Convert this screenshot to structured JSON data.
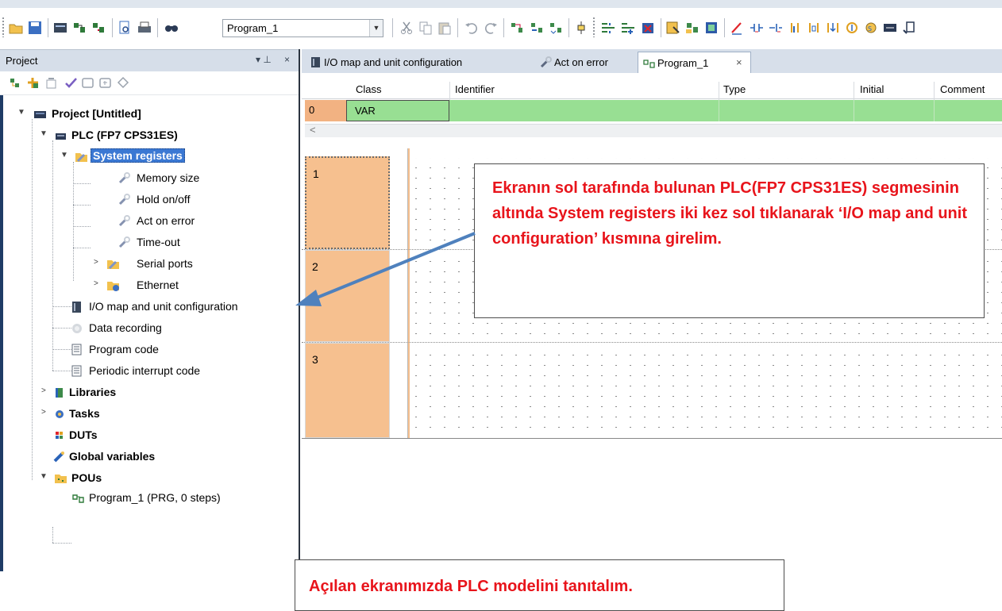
{
  "toolbar": {
    "pou_selector_value": "Program_1",
    "dropdown_glyph": "▼",
    "icons": [
      "open-folder-icon",
      "save-icon",
      "compile-icon",
      "check-program-icon",
      "online-monitor-icon",
      "print-preview-icon",
      "print-icon",
      "find-icon",
      "cut-icon",
      "copy-icon",
      "paste-icon",
      "undo-icon",
      "redo-icon",
      "network-insert-icon",
      "network-delete-icon",
      "network-move-icon",
      "contact-icon",
      "rung-insert-icon",
      "rung-append-icon",
      "rung-delete-icon",
      "function-block-icon",
      "fb-call-icon",
      "fb-box-icon",
      "line-draw-icon",
      "contact-no-icon",
      "coil-icon",
      "parallel-branch-icon",
      "ldd-icon",
      "rising-edge-icon",
      "set-icon",
      "var-icon",
      "label-icon"
    ]
  },
  "project_pane": {
    "title": "Project",
    "pin_glyph": "▾ ⊥",
    "close_glyph": "×",
    "tools": [
      "add-unit-icon",
      "add-plc-icon",
      "remove-icon",
      "check-icon",
      "library-icon",
      "library-add-icon",
      "global-icon"
    ],
    "tree": {
      "root": "Project [Untitled]",
      "plc": "PLC (FP7 CPS31ES)",
      "system_registers": "System registers",
      "memory_size": "Memory size",
      "hold_on_off": "Hold on/off",
      "act_on_error": "Act on error",
      "time_out": "Time-out",
      "serial_ports": "Serial ports",
      "ethernet": "Ethernet",
      "io_map": "I/O map and unit configuration",
      "data_recording": "Data recording",
      "program_code": "Program code",
      "periodic_interrupt": "Periodic interrupt code",
      "libraries": "Libraries",
      "tasks": "Tasks",
      "duts": "DUTs",
      "global_variables": "Global variables",
      "pous": "POUs",
      "program_1": "Program_1 (PRG, 0 steps)"
    }
  },
  "editor": {
    "tabs": [
      {
        "label": "I/O map and unit configuration",
        "active": false
      },
      {
        "label": "Act on error",
        "active": false
      },
      {
        "label": "Program_1",
        "active": true
      }
    ],
    "tab_close": "×",
    "var_table": {
      "columns": [
        "Class",
        "Identifier",
        "Type",
        "Initial",
        "Comment"
      ],
      "rows": [
        {
          "index": "0",
          "class": "VAR",
          "identifier": "",
          "type": "",
          "initial": "",
          "comment": ""
        }
      ],
      "scroll_left_glyph": "<"
    },
    "rungs": [
      "1",
      "2",
      "3"
    ]
  },
  "colors": {
    "var_row_green": "#98df93",
    "rung_orange": "#f6c08f",
    "selection_blue": "#3a78d3",
    "callout_red": "#e8141b",
    "arrow_blue": "#4f81bd"
  },
  "annotations": {
    "callout_1": "Ekranın sol tarafında bulunan PLC(FP7 CPS31ES) segmesinin altında System registers iki kez sol tıklanarak ‘I/O map and unit configuration’ kısmına girelim.",
    "callout_2": "Açılan ekranımızda PLC modelini  tanıtalım."
  }
}
